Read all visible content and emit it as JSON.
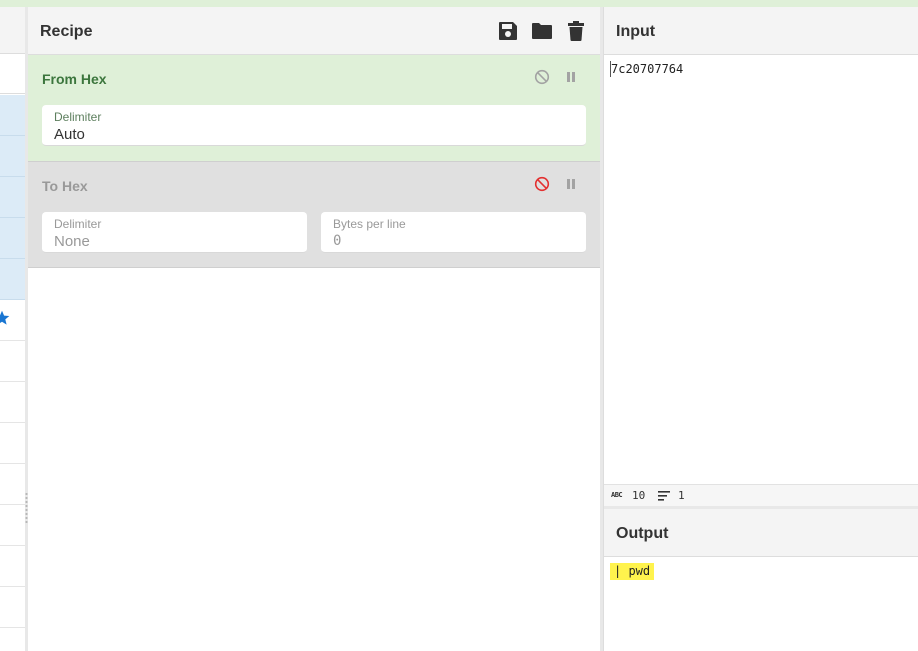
{
  "recipe": {
    "title": "Recipe",
    "operations": [
      {
        "name": "From Hex",
        "state": "enabled",
        "args": [
          {
            "label": "Delimiter",
            "value": "Auto"
          }
        ]
      },
      {
        "name": "To Hex",
        "state": "disabled",
        "args": [
          {
            "label": "Delimiter",
            "value": "None"
          },
          {
            "label": "Bytes per line",
            "value": "0"
          }
        ]
      }
    ]
  },
  "input": {
    "title": "Input",
    "text": "7c20707764",
    "stats": {
      "abc_label": "ABC",
      "length": "10",
      "lines": "1"
    }
  },
  "output": {
    "title": "Output",
    "text": "| pwd"
  },
  "colors": {
    "enabled_bg": "#dff0d8",
    "enabled_title": "#3c763d",
    "disabled_bg": "#e0e0e0",
    "disable_active": "#e33030",
    "highlight": "#fff34d",
    "favourite_star": "#1976d2"
  },
  "icons": [
    "save-icon",
    "folder-icon",
    "trash-icon",
    "disable-icon",
    "pause-icon",
    "star-icon",
    "lines-icon"
  ]
}
